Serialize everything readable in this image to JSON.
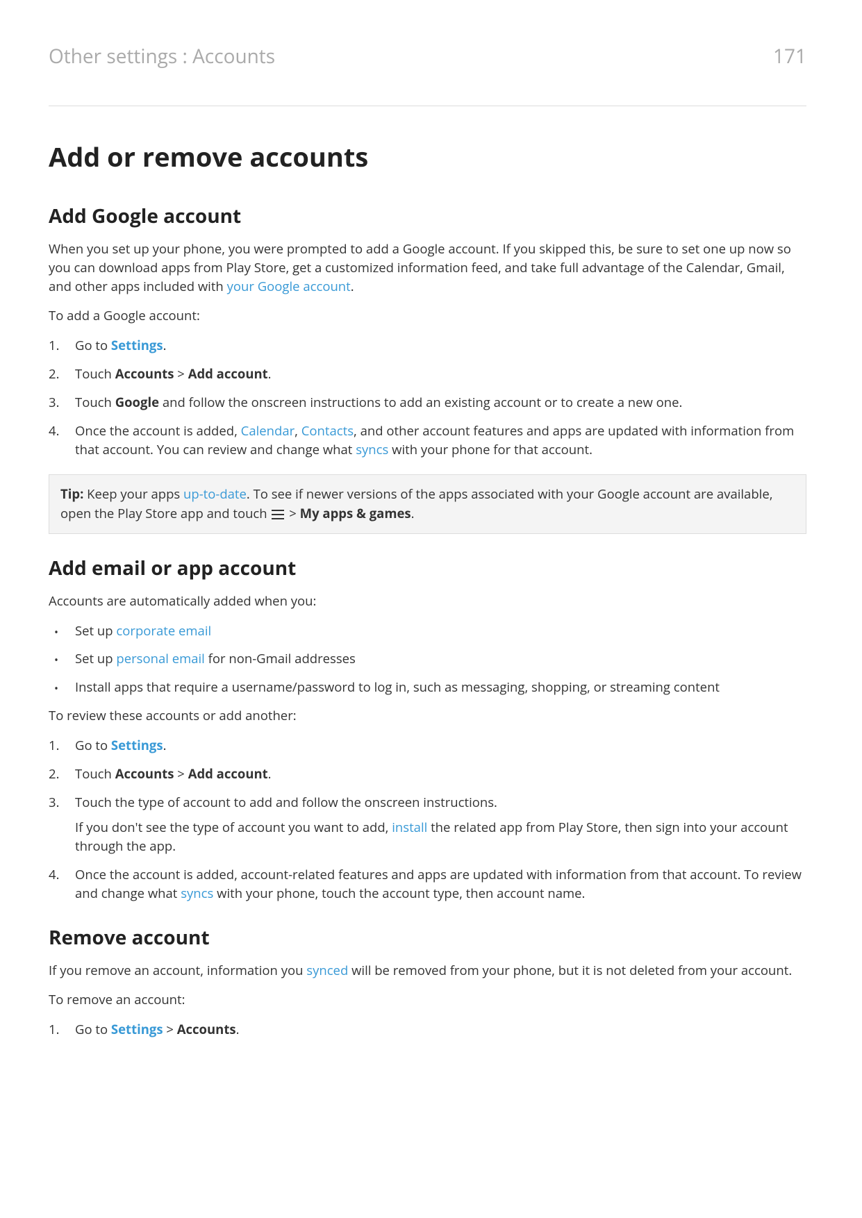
{
  "header": {
    "breadcrumb": "Other settings : Accounts",
    "pageNumber": "171"
  },
  "h1": "Add or remove accounts",
  "section1": {
    "heading": "Add Google account",
    "p1_pre": "When you set up your phone, you were prompted to add a Google account. If you skipped this, be sure to set one up now so you can download apps from Play Store, get a customized information feed, and take full advantage of the Calendar, Gmail, and other apps included with ",
    "p1_link": "your Google account",
    "p1_post": ".",
    "p2": "To add a Google account:",
    "step1_pre": "Go to ",
    "step1_link": "Settings",
    "step1_post": ".",
    "step2_pre": "Touch ",
    "step2_b1": "Accounts",
    "step2_mid": " > ",
    "step2_b2": "Add account",
    "step2_post": ".",
    "step3_pre": "Touch ",
    "step3_b": "Google",
    "step3_post": " and follow the onscreen instructions to add an existing account or to create a new one.",
    "step4_pre": "Once the account is added, ",
    "step4_link1": "Calendar",
    "step4_mid1": ", ",
    "step4_link2": "Contacts",
    "step4_mid2": ", and other account features and apps are updated with information from that account. You can review and change what ",
    "step4_link3": "syncs",
    "step4_post": " with your phone for that account.",
    "tip_label": "Tip:",
    "tip_pre": " Keep your apps ",
    "tip_link": "up-to-date",
    "tip_mid": ". To see if newer versions of the apps associated with your Google account are available, open the Play Store app and touch ",
    "tip_arrow": " > ",
    "tip_b": "My apps & games",
    "tip_post": "."
  },
  "section2": {
    "heading": "Add email or app account",
    "p1": "Accounts are automatically added when you:",
    "bullet1_pre": "Set up ",
    "bullet1_link": "corporate email",
    "bullet2_pre": "Set up ",
    "bullet2_link": "personal email",
    "bullet2_post": " for non-Gmail addresses",
    "bullet3": "Install apps that require a username/password to log in, such as messaging, shopping, or streaming content",
    "p2": "To review these accounts or add another:",
    "step1_pre": "Go to ",
    "step1_link": "Settings",
    "step1_post": ".",
    "step2_pre": "Touch ",
    "step2_b1": "Accounts",
    "step2_mid": " > ",
    "step2_b2": "Add account",
    "step2_post": ".",
    "step3": "Touch the type of account to add and follow the onscreen instructions.",
    "step3b_pre": "If you don't see the type of account you want to add, ",
    "step3b_link": "install",
    "step3b_post": " the related app from Play Store, then sign into your account through the app.",
    "step4_pre": "Once the account is added, account-related features and apps are updated with information from that account. To review and change what ",
    "step4_link": "syncs",
    "step4_post": " with your phone, touch the account type, then account name."
  },
  "section3": {
    "heading": "Remove account",
    "p1_pre": "If you remove an account, information you ",
    "p1_link": "synced",
    "p1_post": " will be removed from your phone, but it is not deleted from your account.",
    "p2": "To remove an account:",
    "step1_pre": "Go to ",
    "step1_link": "Settings",
    "step1_mid": " > ",
    "step1_b": "Accounts",
    "step1_post": "."
  }
}
